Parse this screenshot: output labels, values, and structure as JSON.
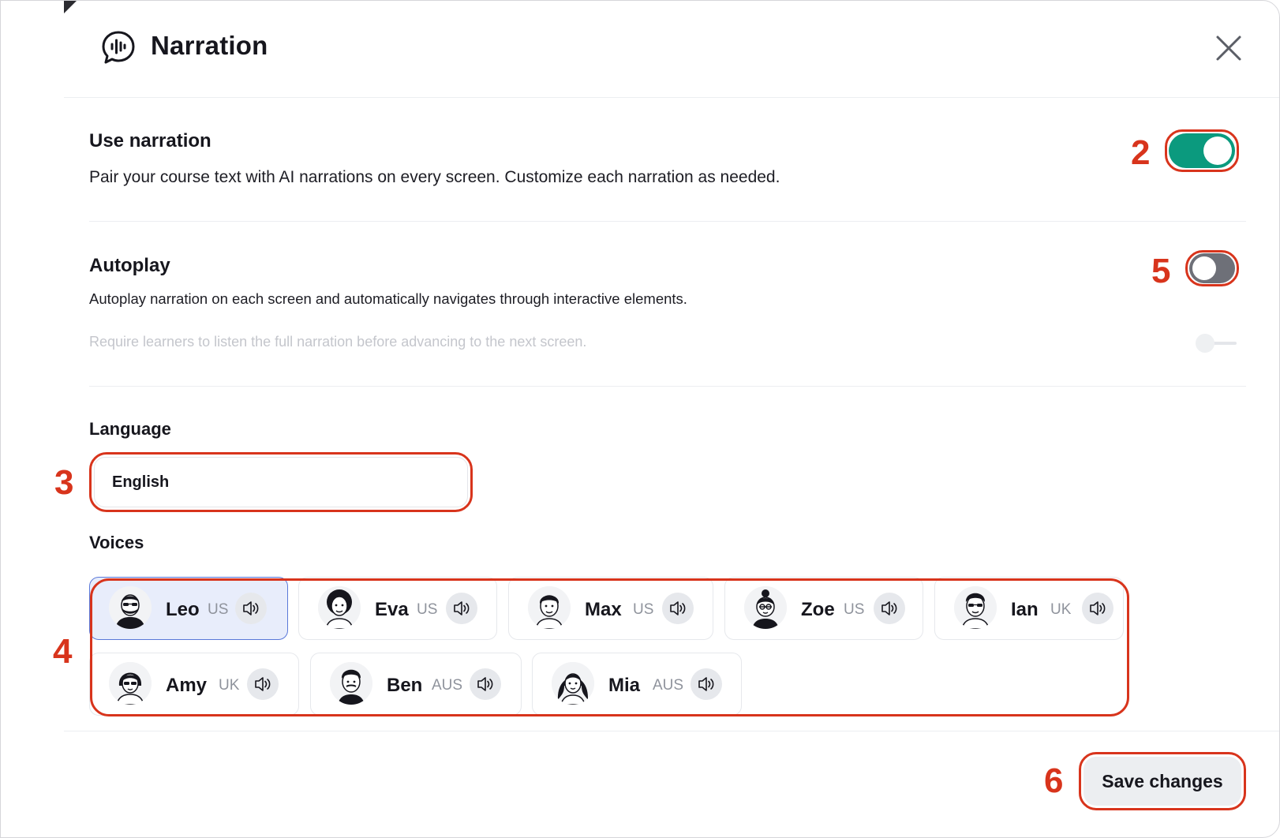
{
  "header": {
    "title": "Narration",
    "logo_icon": "narration-chat-icon",
    "close_icon": "close-icon"
  },
  "use_narration": {
    "title": "Use narration",
    "description": "Pair your course text with AI narrations on every screen. Customize each narration as needed.",
    "enabled": true
  },
  "autoplay": {
    "title": "Autoplay",
    "description": "Autoplay narration on each screen and automatically navigates through interactive elements.",
    "enabled": false,
    "require_full_listen": {
      "label": "Require learners to listen the full narration before advancing to the next screen.",
      "enabled": false,
      "disabled": true
    }
  },
  "language": {
    "label": "Language",
    "value": "English"
  },
  "voices": {
    "label": "Voices",
    "selected": "Leo",
    "items": [
      {
        "name": "Leo",
        "locale": "US",
        "icon": "leo-avatar-icon"
      },
      {
        "name": "Eva",
        "locale": "US",
        "icon": "eva-avatar-icon"
      },
      {
        "name": "Max",
        "locale": "US",
        "icon": "max-avatar-icon"
      },
      {
        "name": "Zoe",
        "locale": "US",
        "icon": "zoe-avatar-icon"
      },
      {
        "name": "Ian",
        "locale": "UK",
        "icon": "ian-avatar-icon"
      },
      {
        "name": "Amy",
        "locale": "UK",
        "icon": "amy-avatar-icon"
      },
      {
        "name": "Ben",
        "locale": "AUS",
        "icon": "ben-avatar-icon"
      },
      {
        "name": "Mia",
        "locale": "AUS",
        "icon": "mia-avatar-icon"
      }
    ]
  },
  "footer": {
    "save_label": "Save changes"
  },
  "annotations": {
    "n2": "2",
    "n3": "3",
    "n4": "4",
    "n5": "5",
    "n6": "6"
  },
  "colors": {
    "toggle_on": "#0b9a7e",
    "toggle_off": "#6e7078",
    "annotation": "#d8341c",
    "selected_voice_bg": "#e8edfb",
    "selected_voice_border": "#5a78d9"
  }
}
